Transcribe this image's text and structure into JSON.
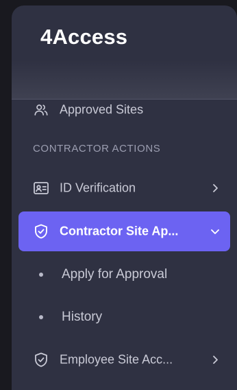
{
  "brand": {
    "name": "4Access"
  },
  "sidebar": {
    "items": [
      {
        "label": "Approved Sites",
        "icon": "users-icon"
      }
    ],
    "section_title": "CONTRACTOR ACTIONS",
    "contractor_items": [
      {
        "label": "ID Verification",
        "icon": "id-card-icon",
        "chevron": "chevron-right-icon"
      },
      {
        "label": "Contractor Site Ap...",
        "icon": "shield-check-icon",
        "chevron": "chevron-down-icon",
        "active": true
      }
    ],
    "sub_items": [
      {
        "label": "Apply for Approval"
      },
      {
        "label": "History"
      }
    ],
    "employee_item": {
      "label": "Employee Site Acc...",
      "icon": "shield-check-icon",
      "chevron": "chevron-right-icon"
    }
  },
  "colors": {
    "background": "#19191f",
    "sidebar": "#2f3142",
    "accent": "#6c63f2",
    "text": "#c9cad6",
    "section": "#9c9eb1"
  }
}
